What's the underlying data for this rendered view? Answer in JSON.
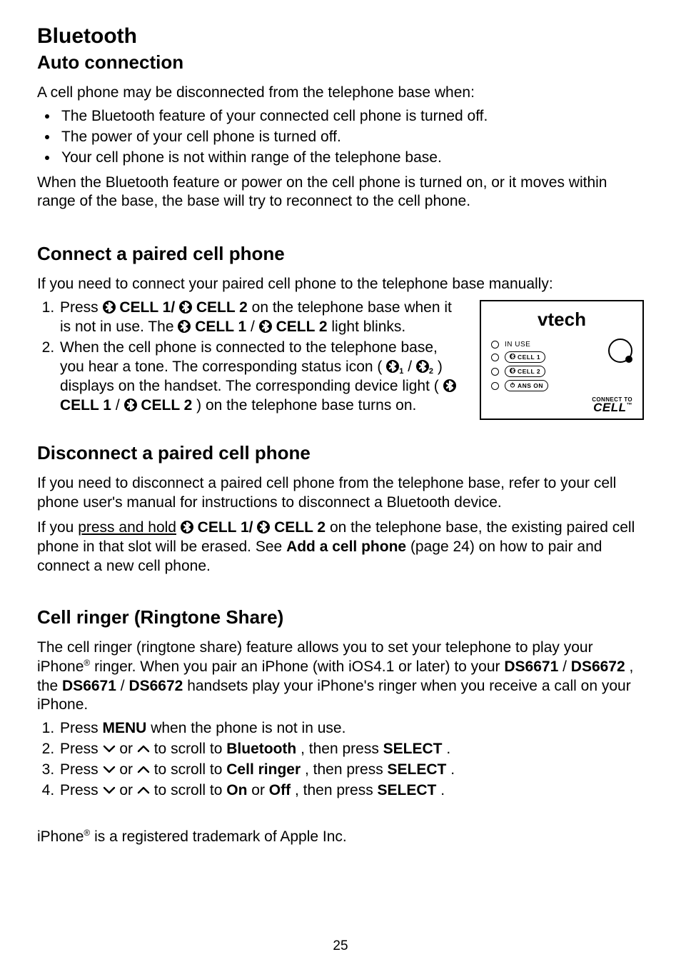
{
  "title": "Bluetooth",
  "section_auto": {
    "heading": "Auto connection",
    "intro": "A cell phone may be disconnected from the telephone base when:",
    "bullets": [
      "The Bluetooth feature of your connected cell phone is turned off.",
      "The power of your cell phone is turned off.",
      "Your cell phone is not within range of the telephone base."
    ],
    "outro": "When the Bluetooth feature or power on the cell phone is turned on, or it moves within range of the base, the base will try to reconnect to the cell phone."
  },
  "section_connect": {
    "heading": "Connect a paired cell phone",
    "intro": "If you need to connect your paired cell phone to the telephone base manually:",
    "steps": {
      "s1": {
        "a": "Press ",
        "b": " CELL 1/",
        "c": " CELL 2",
        "d": " on the telephone base when it is not in use. The ",
        "e": " CELL 1",
        "f": "/",
        "g": " CELL 2",
        "h": " light blinks."
      },
      "s2": {
        "a": "When the cell phone is connected to the telephone base, you hear a tone. The corresponding status icon (",
        "b": "/",
        "c": ") displays on the handset. The corresponding device light (",
        "d": " CELL 1",
        "e": "/",
        "f": " CELL 2",
        "g": ") on the telephone base turns on."
      }
    }
  },
  "section_disconnect": {
    "heading": "Disconnect a paired cell phone",
    "p1": "If you need to disconnect a paired cell phone from the telephone base, refer to your cell phone user's manual for instructions to disconnect a Bluetooth device.",
    "p2": {
      "a": "If you ",
      "pah": "press and hold",
      "b": " ",
      "c": " CELL 1/",
      "d": " CELL 2",
      "e": " on the telephone base, the existing paired cell phone in that slot will be erased. See ",
      "f": "Add a cell phone",
      "g": " (page 24) on how to pair and connect a new cell phone."
    }
  },
  "section_ringer": {
    "heading": "Cell ringer (Ringtone Share)",
    "p1": {
      "a": "The cell ringer (ringtone share) feature allows you to set your telephone to play your iPhone",
      "reg": "®",
      "b": " ringer. When you pair an iPhone (with iOS4.1 or later) to your ",
      "c": "DS6671",
      "d": "/",
      "e": "DS6672",
      "f": ", the ",
      "g": "DS6671",
      "h": "/",
      "i": "DS6672",
      "j": " handsets play your iPhone's ringer when you receive a call on your iPhone."
    },
    "steps": {
      "s1": {
        "a": "Press ",
        "b": "MENU",
        "c": " when the phone is not in use."
      },
      "s2": {
        "a": "Press ",
        "b": " or ",
        "c": " to scroll to ",
        "d": "Bluetooth",
        "e": ", then press ",
        "f": "SELECT",
        "g": "."
      },
      "s3": {
        "a": "Press ",
        "b": " or ",
        "c": " to scroll to ",
        "d": "Cell ringer",
        "e": ", then press ",
        "f": "SELECT",
        "g": "."
      },
      "s4": {
        "a": "Press ",
        "b": " or ",
        "c": " to scroll to ",
        "d": "On",
        "e": " or ",
        "f": "Off",
        "g": ", then press ",
        "h": "SELECT",
        "i": "."
      }
    }
  },
  "trademark": {
    "a": "iPhone",
    "reg": "®",
    "b": " is a registered trademark of Apple Inc."
  },
  "pageNumber": "25",
  "device": {
    "logo": "vtech",
    "inUse": "IN USE",
    "cell1": "CELL 1",
    "cell2": "CELL 2",
    "ansOn": "ANS ON",
    "connectTo": "CONNECT TO",
    "cell": "CELL",
    "tm": "™"
  },
  "icons": {
    "sub1": "1",
    "sub2": "2"
  }
}
